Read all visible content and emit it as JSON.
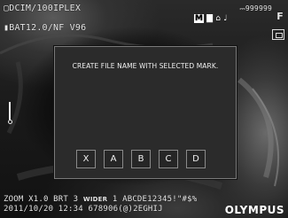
{
  "osd": {
    "folder": "▢DCIM/100IPLEX",
    "battery": "▮BAT12.0/NF V96",
    "counter": "⎓999999",
    "status_icons": [
      {
        "name": "memory-icon",
        "glyph": "M"
      },
      {
        "name": "image-quality-icon",
        "glyph": "▇"
      },
      {
        "name": "lock-icon",
        "glyph": "⌂"
      },
      {
        "name": "audio-icon",
        "glyph": "♩"
      }
    ],
    "file_mode": "F",
    "bottom_line1_left": "ZOOM X1.0  BRT 3",
    "bottom_wider": "WIDER",
    "bottom_line1_right": "1  ABCDE12345!\"#$%",
    "bottom_line2": "2011/10/20 12:34      678906(@)2EGHIJ",
    "brand": "OLYMPUS"
  },
  "dialog": {
    "message": "CREATE FILE NAME WITH SELECTED MARK.",
    "marks": [
      "X",
      "A",
      "B",
      "C",
      "D"
    ]
  }
}
